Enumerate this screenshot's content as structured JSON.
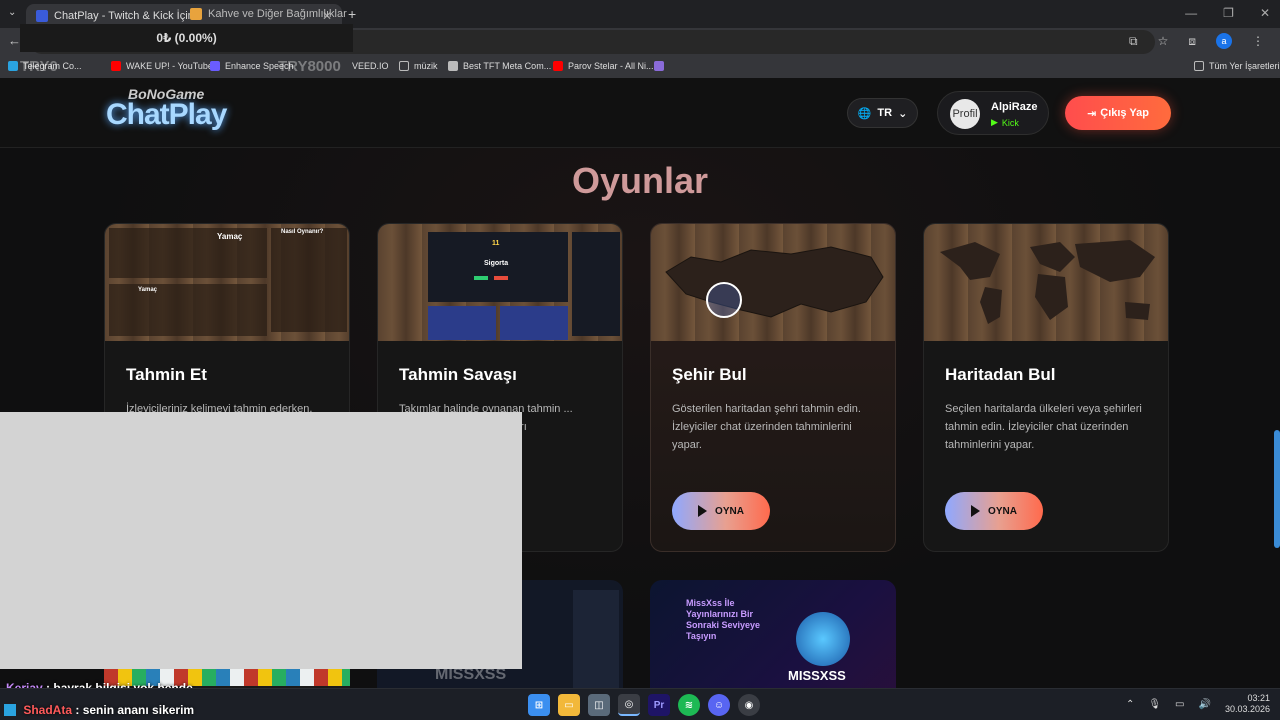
{
  "browser": {
    "tabs": [
      {
        "label": "ChatPlay - Twitch & Kick İçin",
        "active": true
      },
      {
        "label": "Kahve ve Diğer Bağımlılıklar",
        "active": false
      }
    ],
    "new_tab": "+",
    "bookmarks": [
      "Telegram Co...",
      "WAKE UP! - YouTube",
      "Enhance Speech",
      "VEED.IO",
      "müzik",
      "Best TFT Meta Com...",
      "Parov Stelar - All Ni...",
      "Tüm Yer İşaretleri"
    ]
  },
  "overlay": {
    "price": "0₺ (0.00%)",
    "try_left": "TRY0",
    "try_right": "TRY8000"
  },
  "header": {
    "logo_small": "BoNoGame",
    "logo_big": "ChatPlay",
    "lang": "TR",
    "user_avatar_text": "Profil",
    "username": "AlpiRaze",
    "platform": "Kick",
    "logout": "Çıkış Yap"
  },
  "section": {
    "title": "Oyunlar"
  },
  "cards": [
    {
      "title": "Tahmin Et",
      "desc": "İzleyicileriniz kelimeyi tahmin ederken,",
      "thumb_heading": "Yamaç",
      "thumb_sub": "Nasıl Oynanır?"
    },
    {
      "title": "Tahmin Savaşı",
      "desc": "Takımlar halinde oynanan tahmin ... yasaklı ... e rakip takımları",
      "thumb_word": "Sigorta",
      "thumb_count": "11"
    },
    {
      "title": "Şehir Bul",
      "desc": "Gösterilen haritadan şehri tahmin edin. İzleyiciler chat üzerinden tahminlerini yapar.",
      "button": "OYNA"
    },
    {
      "title": "Haritadan Bul",
      "desc": "Seçilen haritalarda ülkeleri veya şehirleri tahmin edin. İzleyiciler chat üzerinden tahminlerini yapar.",
      "button": "OYNA"
    }
  ],
  "bottom_cards": [
    {
      "brand": "MISSXSS"
    },
    {
      "headline": "MissXss İle Yayınlarınızı Bir Sonraki Seviyeye Taşıyın",
      "brand": "MISSXSS"
    }
  ],
  "chat": [
    {
      "user": "Keriav",
      "msg": ": bayrak bilgisi yok bende",
      "color": "#c58af9"
    },
    {
      "user": "ShadAta",
      "msg": ": senin ananı sikerim",
      "color": "#ff5a5a"
    }
  ],
  "taskbar": {
    "time": "03:21",
    "date": "30.03.2026"
  },
  "colors": {
    "accent": "#ff5a3d",
    "kick": "#53fc18",
    "title": "#cf9a9a"
  }
}
